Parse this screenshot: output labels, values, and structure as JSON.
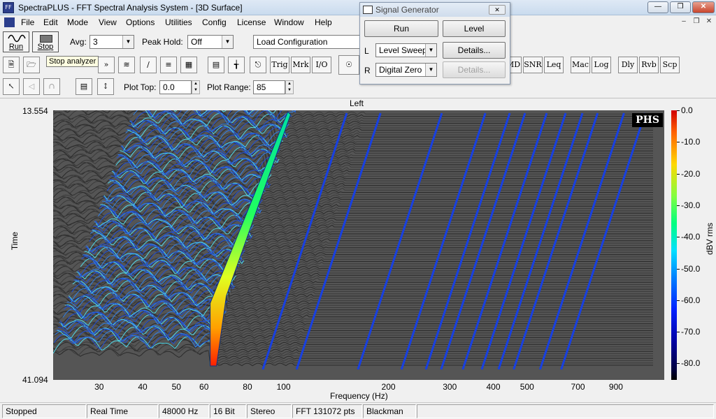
{
  "window": {
    "title": "SpectraPLUS - FFT Spectral Analysis System - [3D Surface]",
    "app_icon": "spectraplus-app-icon"
  },
  "menubar": [
    "File",
    "Edit",
    "Mode",
    "View",
    "Options",
    "Utilities",
    "Config",
    "License",
    "Window",
    "Help"
  ],
  "toolbar": {
    "run_label": "Run",
    "stop_label": "Stop",
    "avg_label": "Avg:",
    "avg_value": "3",
    "peak_hold_label": "Peak Hold:",
    "peak_hold_value": "Off",
    "load_config_value": "Load Configuration",
    "tooltip": "Stop analyzer",
    "text_buttons": [
      "Trig",
      "Mrk",
      "I/O",
      "MD",
      "SNR",
      "Leq",
      "Mac",
      "Log",
      "Dly",
      "Rvb",
      "Scp"
    ],
    "plot_top_label": "Plot Top:",
    "plot_top_value": "0.0",
    "plot_range_label": "Plot Range:",
    "plot_range_value": "85"
  },
  "signal_generator": {
    "title": "Signal Generator",
    "run_label": "Run",
    "level_label": "Level",
    "left_channel_label": "L",
    "left_mode": "Level Sweep",
    "left_details": "Details...",
    "right_channel_label": "R",
    "right_mode": "Digital Zero",
    "right_details": "Details..."
  },
  "plot": {
    "title": "Left",
    "y_axis_label": "Time",
    "y_top": "13.554",
    "y_bottom": "41.094",
    "x_axis_label": "Frequency (Hz)",
    "x_ticks": [
      "30",
      "40",
      "50",
      "60",
      "80",
      "100",
      "200",
      "300",
      "400",
      "500",
      "700",
      "900"
    ],
    "colorbar_label": "dBV rms",
    "colorbar_ticks": [
      "0.0",
      "-10.0",
      "-20.0",
      "-30.0",
      "-40.0",
      "-50.0",
      "-60.0",
      "-70.0",
      "-80.0"
    ],
    "logo": "PHS"
  },
  "chart_data": {
    "type": "heatmap",
    "title": "Left",
    "xlabel": "Frequency (Hz)",
    "ylabel": "Time",
    "x_scale": "log",
    "xlim": [
      22,
      1250
    ],
    "ylim": [
      41.094,
      13.554
    ],
    "x_ticks": [
      30,
      40,
      50,
      60,
      80,
      100,
      200,
      300,
      400,
      500,
      700,
      900
    ],
    "colorbar": {
      "label": "dBV rms",
      "range": [
        -85,
        0
      ]
    },
    "series": [
      {
        "frequency_hz": 63,
        "peak_dbv": -5
      }
    ]
  },
  "status": {
    "state": "Stopped",
    "mode": "Real Time",
    "rate": "48000 Hz",
    "bits": "16 Bit",
    "channels": "Stereo",
    "fft": "FFT 131072 pts",
    "window": "Blackman"
  }
}
